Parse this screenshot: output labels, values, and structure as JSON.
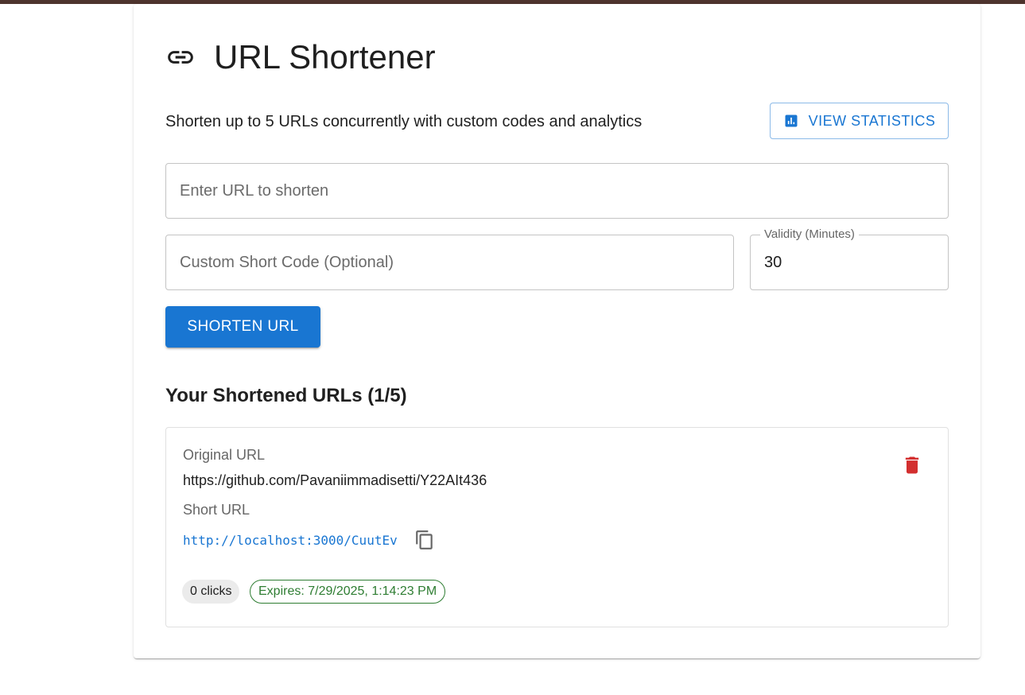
{
  "header": {
    "title": "URL Shortener",
    "title_icon": "link-icon",
    "subtitle": "Shorten up to 5 URLs concurrently with custom codes and analytics",
    "stats_button_label": "VIEW STATISTICS",
    "stats_icon": "bar-chart-icon"
  },
  "form": {
    "url_placeholder": "Enter URL to shorten",
    "url_value": "",
    "code_placeholder": "Custom Short Code (Optional)",
    "code_value": "",
    "validity_label": "Validity (Minutes)",
    "validity_value": "30",
    "submit_label": "SHORTEN URL"
  },
  "results": {
    "section_title": "Your Shortened URLs (1/5)",
    "items": [
      {
        "original_label": "Original URL",
        "original_url": "https://github.com/Pavaniimmadisetti/Y22AIt436",
        "short_label": "Short URL",
        "short_url": "http://localhost:3000/CuutEv",
        "clicks": "0 clicks",
        "expires": "Expires: 7/29/2025, 1:14:23 PM"
      }
    ]
  },
  "colors": {
    "primary": "#1976d2",
    "topbar": "#4e342e",
    "delete": "#d32f2f",
    "expires": "#2e7d32"
  }
}
